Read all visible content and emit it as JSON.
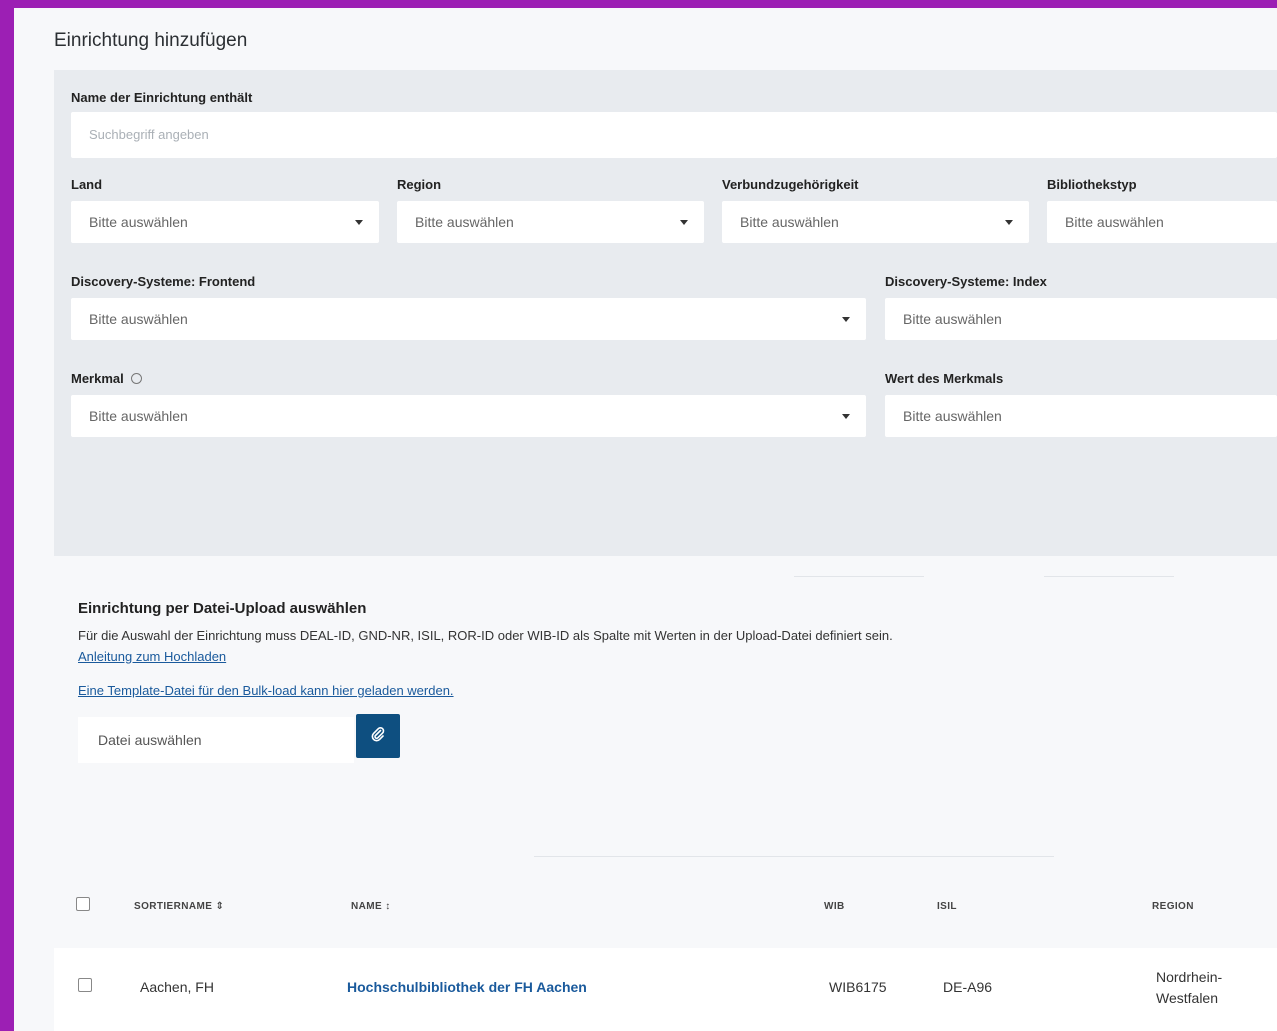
{
  "page": {
    "title": "Einrichtung hinzufügen"
  },
  "filters": {
    "name_label": "Name der Einrichtung enthält",
    "name_placeholder": "Suchbegriff angeben",
    "select_placeholder": "Bitte auswählen",
    "land_label": "Land",
    "region_label": "Region",
    "verbund_label": "Verbundzugehörigkeit",
    "bibliothekstyp_label": "Bibliothekstyp",
    "discovery_frontend_label": "Discovery-Systeme: Frontend",
    "discovery_index_label": "Discovery-Systeme: Index",
    "merkmal_label": "Merkmal",
    "wert_label": "Wert des Merkmals"
  },
  "upload": {
    "title": "Einrichtung per Datei-Upload auswählen",
    "description": "Für die Auswahl der Einrichtung muss DEAL-ID, GND-NR, ISIL, ROR-ID oder WIB-ID als Spalte mit Werten in der Upload-Datei definiert sein.",
    "guide_link": "Anleitung zum Hochladen",
    "template_link": "Eine Template-Datei für den Bulk-load kann hier geladen werden.",
    "file_placeholder": "Datei auswählen"
  },
  "table": {
    "headers": {
      "sortname": "SORTIERNAME ⇕",
      "name": "NAME ↕",
      "wib": "WIB",
      "isil": "ISIL",
      "region": "REGION"
    },
    "rows": [
      {
        "sortname": "Aachen, FH",
        "name": "Hochschulbibliothek der FH Aachen",
        "wib": "WIB6175",
        "isil": "DE-A96",
        "region_line1": "Nordrhein-",
        "region_line2": "Westfalen"
      }
    ]
  },
  "colors": {
    "accent": "#9c1fb4",
    "primary_button": "#0e4f80",
    "link": "#1a5a9c"
  }
}
